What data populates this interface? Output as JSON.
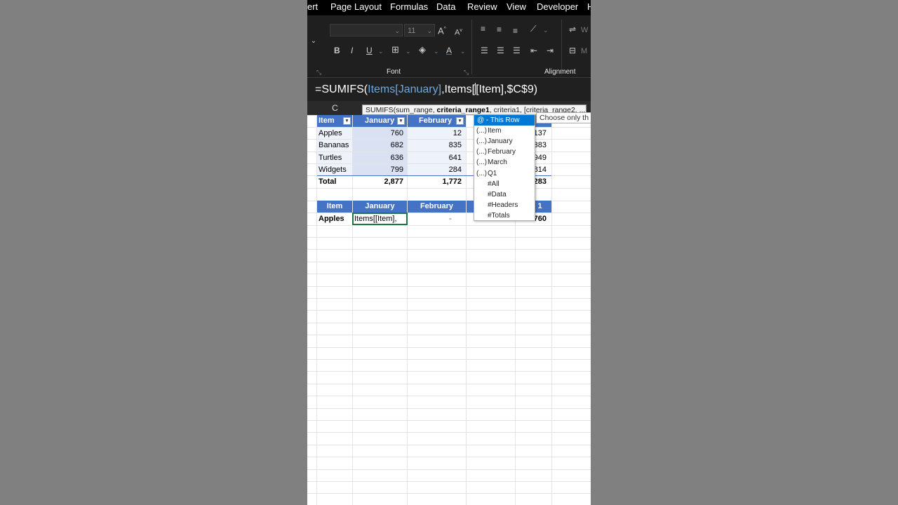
{
  "menu": {
    "items": [
      "ert",
      "Page Layout",
      "Formulas",
      "Data",
      "Review",
      "View",
      "Developer",
      "H"
    ]
  },
  "ribbon": {
    "font_size": "11",
    "font_group_label": "Font",
    "alignment_group_label": "Alignment",
    "bold": "B",
    "italic": "I",
    "underline": "U",
    "font_color": "A",
    "grow_font": "A",
    "shrink_font": "A",
    "wrap_partial": "W",
    "merge_partial": "M"
  },
  "formula_bar": {
    "part1": "=SUMIFS(",
    "part2": "Items[January]",
    "part3": ",Items[",
    "part4": "[Item],$C$9)"
  },
  "column_header": "C",
  "tooltip": {
    "prefix": "SUMIFS(sum_range, ",
    "bold": "criteria_range1",
    "suffix": ", criteria1, [criteria_range2, ...)"
  },
  "tip2": "Choose only th",
  "autocomplete": {
    "items": [
      {
        "bracket": "",
        "label": "@ - This Row",
        "selected": true
      },
      {
        "bracket": "(...)",
        "label": "Item"
      },
      {
        "bracket": "(...)",
        "label": "January"
      },
      {
        "bracket": "(...)",
        "label": "February"
      },
      {
        "bracket": "(...)",
        "label": "March"
      },
      {
        "bracket": "(...)",
        "label": "Q1"
      },
      {
        "bracket": "",
        "label": "#All"
      },
      {
        "bracket": "",
        "label": "#Data"
      },
      {
        "bracket": "",
        "label": "#Headers"
      },
      {
        "bracket": "",
        "label": "#Totals"
      }
    ]
  },
  "table1": {
    "headers": [
      "Item",
      "January",
      "February"
    ],
    "rows": [
      {
        "item": "Apples",
        "jan": "760",
        "feb": "12",
        "q1": "137"
      },
      {
        "item": "Bananas",
        "jan": "682",
        "feb": "835",
        "q1": "383"
      },
      {
        "item": "Turtles",
        "jan": "636",
        "feb": "641",
        "q1": "949"
      },
      {
        "item": "Widgets",
        "jan": "799",
        "feb": "284",
        "q1": "814"
      }
    ],
    "total": {
      "label": "Total",
      "jan": "2,877",
      "feb": "1,772",
      "q1": "283"
    }
  },
  "table2": {
    "headers": [
      "Item",
      "January",
      "February",
      "1"
    ],
    "row": {
      "item": "Apples",
      "editing": "Items[[Item],",
      "feb": "-",
      "q1": "760"
    }
  },
  "colors": {
    "header_blue": "#4472c4",
    "band_light": "#d9e1f2",
    "selection_green": "#217346",
    "dropdown_sel": "#0078d4"
  }
}
